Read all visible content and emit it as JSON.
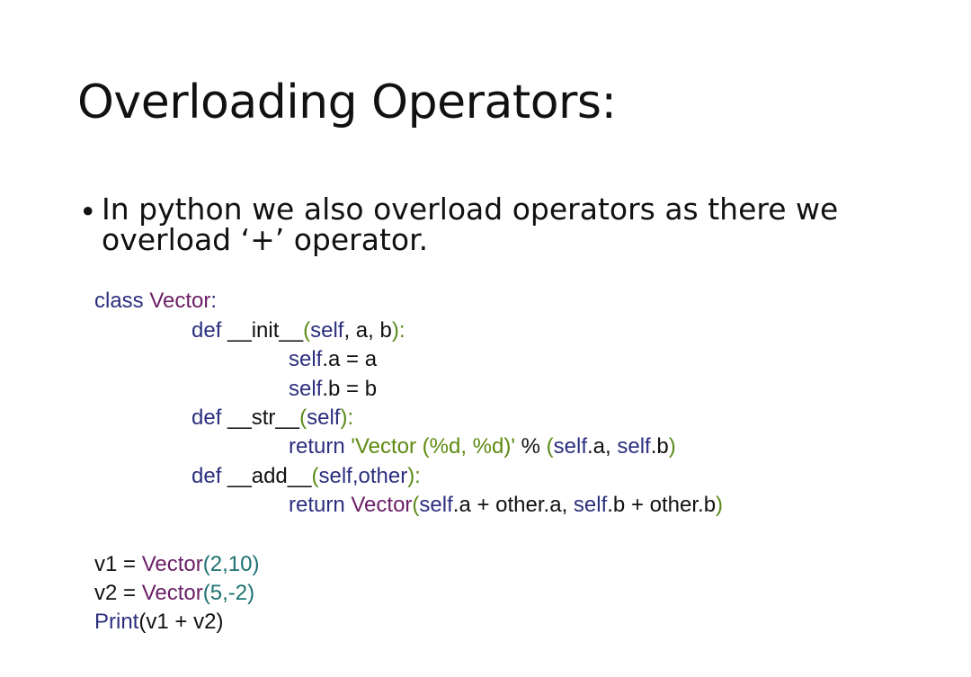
{
  "slide": {
    "title": "Overloading Operators:",
    "bullet_symbol": "•",
    "bullet_line1": "In python we also overload operators as there we",
    "bullet_line2": "overload ‘+’ operator."
  },
  "code": {
    "line1": {
      "a": "class ",
      "b": "Vector",
      "c": ":"
    },
    "line2": {
      "a": "def ",
      "b": "__init__",
      "c": "(",
      "d": "self",
      "e": ", a, b",
      "f": "):"
    },
    "line3": {
      "a": "self",
      "b": ".a",
      "c": " = ",
      "d": "a"
    },
    "line4": {
      "a": "self",
      "b": ".b",
      "c": " = ",
      "d": "b"
    },
    "line5": {
      "a": "def ",
      "b": "__str__",
      "c": "(",
      "d": "self",
      "e": "):"
    },
    "line6": {
      "a": "return ",
      "b": "'Vector (%d, %d)'",
      "c": " % ",
      "d": "(",
      "e": "self",
      "f": ".a, ",
      "g": "self",
      "h": ".b",
      "i": ")"
    },
    "line7": {
      "a": "def ",
      "b": "__add__",
      "c": "(",
      "d": "self,other",
      "e": "):"
    },
    "line8": {
      "a": "return ",
      "b": "Vector",
      "c": "(",
      "d": "self",
      "e": ".a",
      "f": " + ",
      "g": "other",
      "h": ".a, ",
      "i": "self",
      "j": ".b",
      "k": " + ",
      "l": "other",
      "m": ".b",
      "n": ")"
    },
    "line9": {
      "a": "v1",
      "b": " = ",
      "c": "Vector",
      "d": "(2,10)"
    },
    "line10": {
      "a": "v2",
      "b": " = ",
      "c": "Vector",
      "d": "(5,-2)"
    },
    "line11": {
      "a": "Print",
      "b": "(",
      "c": "v1",
      "d": " + ",
      "e": "v2",
      "f": ")"
    }
  },
  "colors": {
    "keyword": "#2b2f7e",
    "class_name": "#6b1f66",
    "numbers": "#1e7272",
    "string": "#5e8a12",
    "text": "#111111"
  }
}
